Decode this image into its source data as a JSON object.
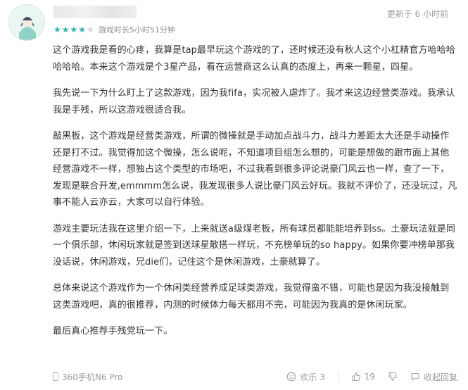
{
  "review": {
    "timestamp": "更新于 6 小时前",
    "rating": {
      "value": 4,
      "max": 5
    },
    "playtime": "游戏时长5小时51分钟",
    "paragraphs": [
      "这个游戏我是看的心疼，我算是tap最早玩这个游戏的了，还时候还没有秋人这个小杠精官方哈哈哈哈哈哈。本来这个游戏是个3星产品，看在运营商这么认真的态度上，再来一颗星，四星。",
      "我先说一下为什么盯上了这款游戏，因为我fifa，实况被人虐炸了。我才来这边经营类游戏。我承认我是手残，所以这游戏很适合我。",
      "敲黑板，这个游戏是经营类游戏，所谓的微操就是手动加点战斗力，战斗力差距太大还是手动操作还是打不过。我觉得加这个微操，怎么说呢，不知道项目组怎么想的，可能是想做的跟市面上其他经营游戏不一样，想独占这个类型的市场吧，不过我看到很多评论说豪门风云也一样，查了一下，发现是联合开发,emmmm怎么说，我发现很多人说比豪门风云好玩。我就不评价了，还没玩过，凡事不能人云亦云，大家可以自行体验。",
      "游戏主要玩法我在这里介绍一下，上来就送a级煤老板，所有球员都能能培养到ss。土豪玩法就是同一个俱乐部，休闲玩家就是签到送球星散搭一样玩，不充榜单玩的so happy。如果你要冲榜单那我没话说，休闲游戏，兄die们，记住这个是休闲游戏，土豪就算了。",
      "总体来说这个游戏作为一个休闲类经营养成足球类游戏，我觉得蛮不错，可能也是因为我没接触到这类游戏吧，真的很推荐，内测的时候体力每天都用不完，可能因为我真的是休闲玩家。",
      "最后真心推荐手残党玩一下。"
    ],
    "device": "360手机N6 Pro",
    "actions": {
      "funny": "欢乐 3",
      "upvotes": "19",
      "reply": "收起回复"
    }
  },
  "colors": {
    "accent": "#2bb6a8",
    "muted": "#9a9a9a",
    "text": "#333333"
  }
}
